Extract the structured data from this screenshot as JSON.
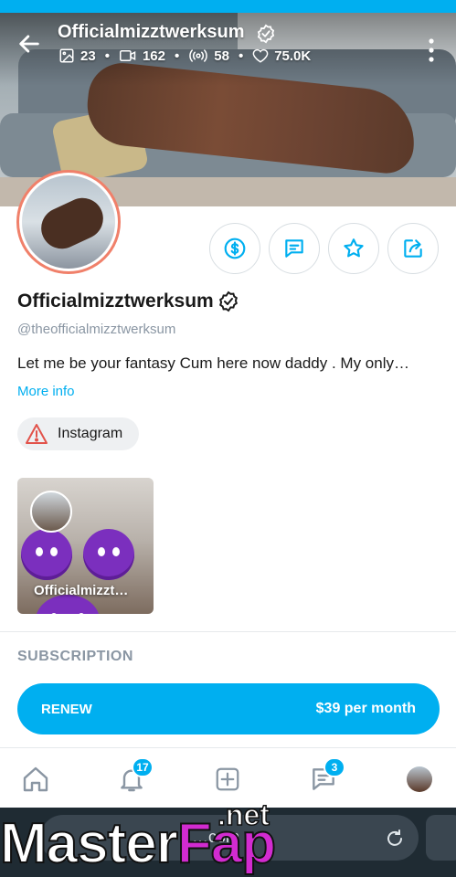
{
  "header": {
    "title": "Officialmizztwerksum",
    "stats": {
      "photos": "23",
      "videos": "162",
      "streams": "58",
      "likes": "75.0K"
    }
  },
  "profile": {
    "name": "Officialmizztwerksum",
    "handle": "@theofficialmizztwerksum",
    "bio": "Let me be your fantasy Cum here now daddy . My only…",
    "more_info": "More info"
  },
  "social_link": {
    "label": "Instagram"
  },
  "highlight": {
    "label": "Officialmizzt…"
  },
  "subscription": {
    "section_title": "SUBSCRIPTION",
    "button_label": "RENEW",
    "price": "$39 per month"
  },
  "nav": {
    "notifications_count": "17",
    "messages_count": "3"
  },
  "browser": {
    "url": "…com"
  },
  "watermark": {
    "part1": "Master",
    "part2": "Fap",
    "part3": ".net"
  },
  "colors": {
    "accent": "#00aff0",
    "avatar_ring": "#f0806a",
    "warning": "#e2524a"
  }
}
